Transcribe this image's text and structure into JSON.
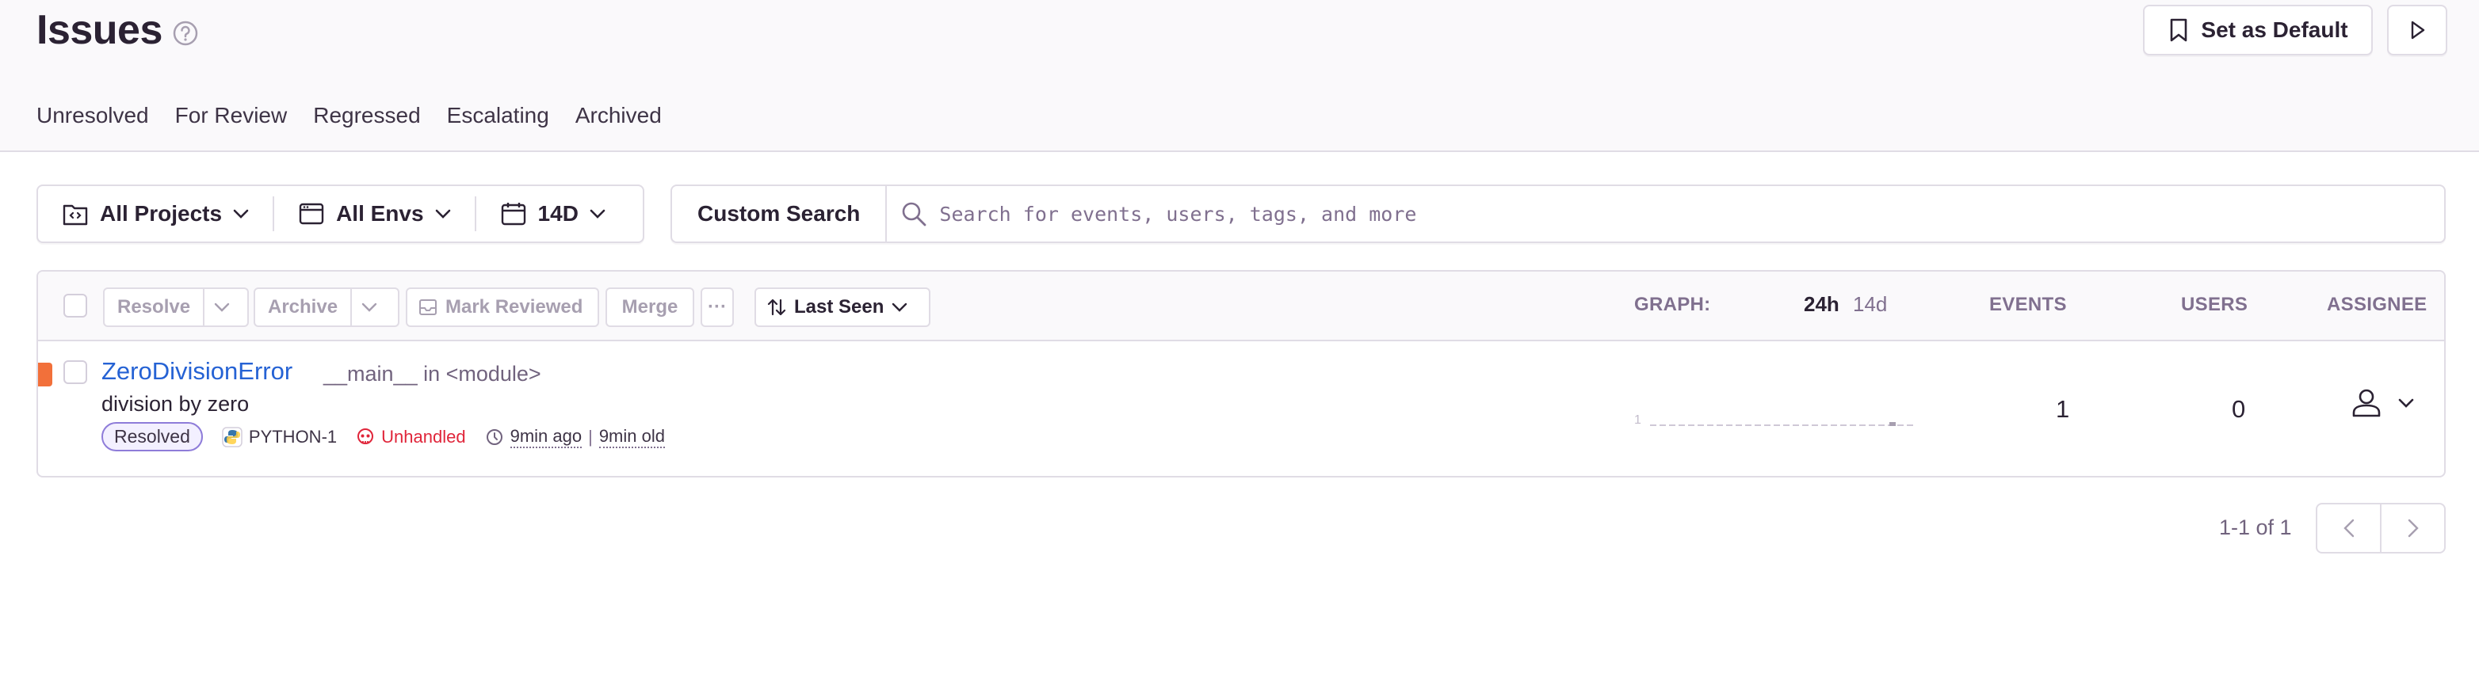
{
  "page": {
    "title": "Issues"
  },
  "header_actions": {
    "set_default_label": "Set as Default"
  },
  "tabs": [
    {
      "label": "Unresolved"
    },
    {
      "label": "For Review"
    },
    {
      "label": "Regressed"
    },
    {
      "label": "Escalating"
    },
    {
      "label": "Archived"
    }
  ],
  "filters": {
    "projects": "All Projects",
    "envs": "All Envs",
    "period": "14D"
  },
  "search": {
    "custom_label": "Custom Search",
    "placeholder": "Search for events, users, tags, and more"
  },
  "toolbar": {
    "resolve": "Resolve",
    "archive": "Archive",
    "mark_reviewed": "Mark Reviewed",
    "merge": "Merge",
    "more": "···",
    "sort": "Last Seen"
  },
  "columns": {
    "graph": "GRAPH:",
    "period_24h": "24h",
    "period_14d": "14d",
    "events": "EVENTS",
    "users": "USERS",
    "assignee": "ASSIGNEE"
  },
  "issues": [
    {
      "title": "ZeroDivisionError",
      "location": "__main__ in <module>",
      "message": "division by zero",
      "status": "Resolved",
      "short_id": "PYTHON-1",
      "handled": "Unhandled",
      "last_seen": "9min ago",
      "age": "9min old",
      "graph_max_label": "1",
      "events": "1",
      "users": "0"
    }
  ],
  "pagination": {
    "text": "1-1 of 1"
  },
  "colors": {
    "accent_link": "#2562d4",
    "level_error": "#f2703a",
    "unhandled": "#e0253a",
    "resolved_badge_border": "#8e7cd9"
  }
}
